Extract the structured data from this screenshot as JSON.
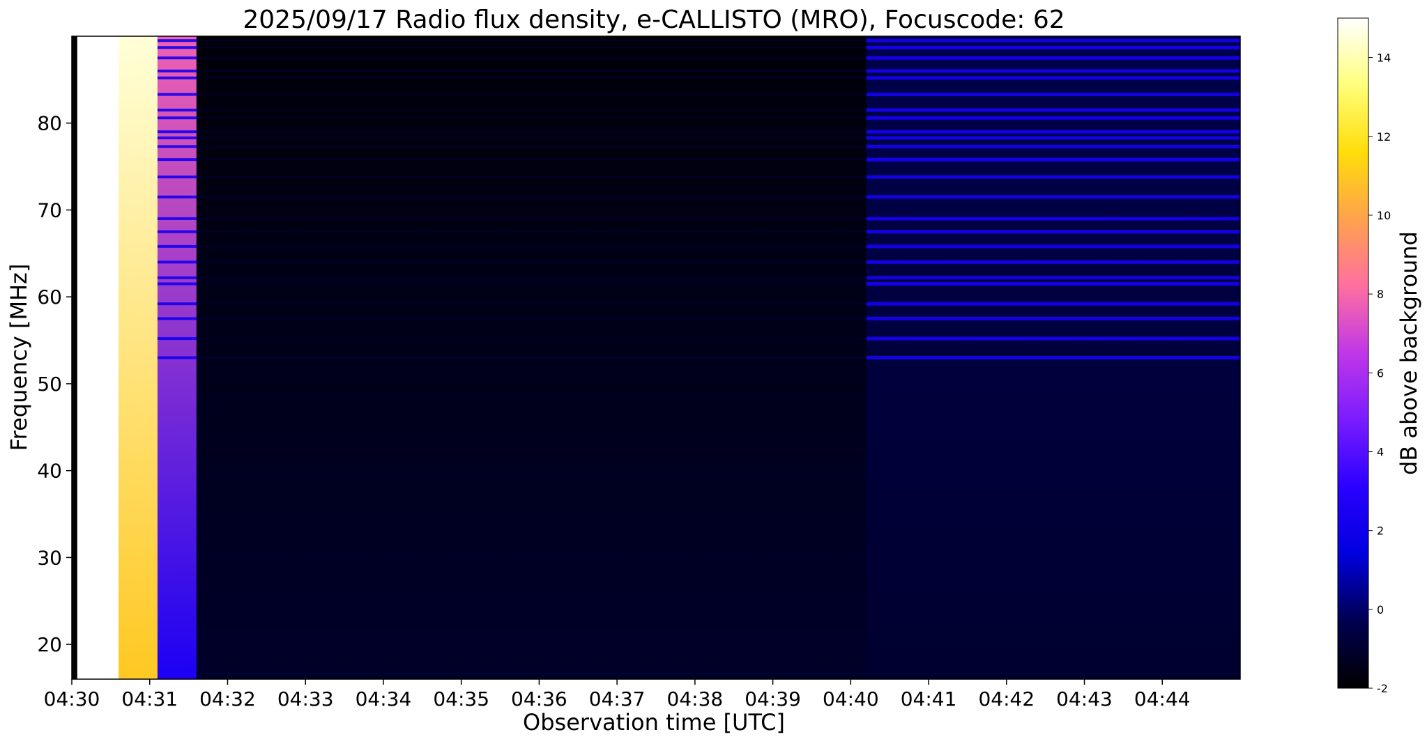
{
  "chart_data": {
    "type": "heatmap",
    "title": "2025/09/17  Radio flux density, e-CALLISTO (MRO), Focuscode: 62",
    "xlabel": "Observation time [UTC]",
    "ylabel": "Frequency [MHz]",
    "colorbar_label": "dB above background",
    "colormap": "gnuplot2",
    "colormap_stops": [
      "#000000",
      "#000050",
      "#0000dd",
      "#2a00ff",
      "#7a1cff",
      "#c037e8",
      "#ff6f9f",
      "#ffa24d",
      "#ffdd0a",
      "#ffff7a",
      "#ffffff"
    ],
    "color_range": [
      -2,
      15
    ],
    "colorbar_ticks": [
      -2,
      0,
      2,
      4,
      6,
      8,
      10,
      12,
      14
    ],
    "x_range_minutes": [
      0,
      15
    ],
    "x_ticks": [
      {
        "minute": 0,
        "label": "04:30"
      },
      {
        "minute": 1,
        "label": "04:31"
      },
      {
        "minute": 2,
        "label": "04:32"
      },
      {
        "minute": 3,
        "label": "04:33"
      },
      {
        "minute": 4,
        "label": "04:34"
      },
      {
        "minute": 5,
        "label": "04:35"
      },
      {
        "minute": 6,
        "label": "04:36"
      },
      {
        "minute": 7,
        "label": "04:37"
      },
      {
        "minute": 8,
        "label": "04:38"
      },
      {
        "minute": 9,
        "label": "04:39"
      },
      {
        "minute": 10,
        "label": "04:40"
      },
      {
        "minute": 11,
        "label": "04:41"
      },
      {
        "minute": 12,
        "label": "04:42"
      },
      {
        "minute": 13,
        "label": "04:43"
      },
      {
        "minute": 14,
        "label": "04:44"
      }
    ],
    "ylim": [
      16,
      90
    ],
    "y_ticks": [
      20,
      30,
      40,
      50,
      60,
      70,
      80
    ],
    "segments": [
      {
        "t0": 0.0,
        "t1": 0.07,
        "level_low": -2,
        "level_high": -2
      },
      {
        "t0": 0.07,
        "t1": 0.6,
        "level_low": 15,
        "level_high": 15
      },
      {
        "t0": 0.6,
        "t1": 1.1,
        "level_low": 11,
        "level_high": 14.5
      },
      {
        "t0": 1.1,
        "t1": 1.6,
        "level_low": 2.5,
        "level_high": 7.8
      },
      {
        "t0": 1.6,
        "t1": 10.2,
        "level_low": -1.1,
        "level_high": -1.8
      },
      {
        "t0": 10.2,
        "t1": 15.0,
        "level_low": -1.0,
        "level_high": -0.4
      }
    ],
    "interference_lines_mhz": [
      89.5,
      88.7,
      87.5,
      86.0,
      85.2,
      83.3,
      81.5,
      80.6,
      79.0,
      78.3,
      77.3,
      75.8,
      73.8,
      71.5,
      69.0,
      67.5,
      65.8,
      64.0,
      62.2,
      61.5,
      59.2,
      57.5,
      55.2,
      53.0
    ],
    "interference_level": 2.2
  }
}
